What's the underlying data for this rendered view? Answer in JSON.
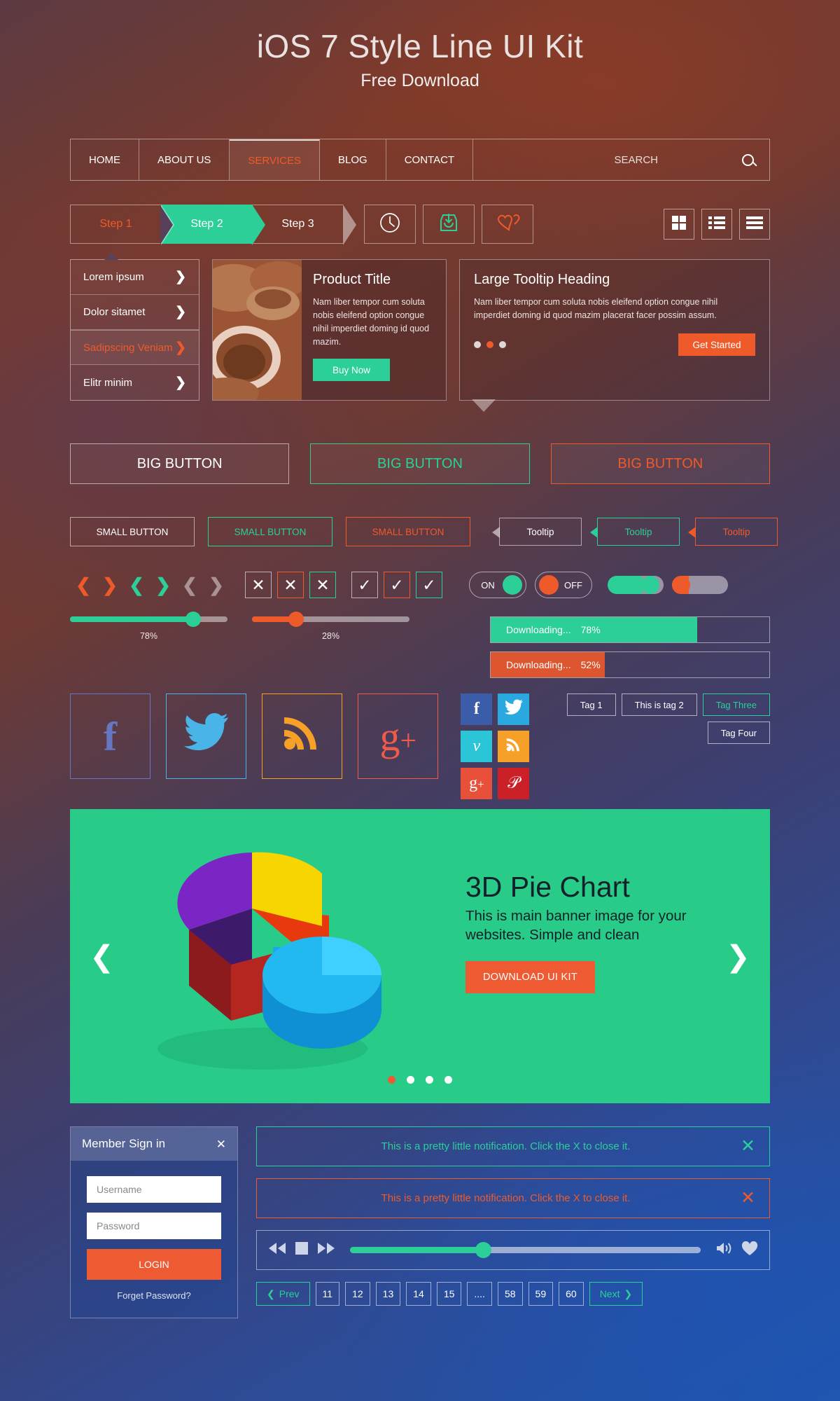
{
  "header": {
    "title": "iOS 7 Style Line UI Kit",
    "subtitle": "Free Download"
  },
  "nav": {
    "items": [
      "HOME",
      "ABOUT US",
      "SERVICES",
      "BLOG",
      "CONTACT"
    ],
    "search_placeholder": "SEARCH",
    "search_icon": "search-icon"
  },
  "steps": {
    "items": [
      "Step 1",
      "Step 2",
      "Step 3"
    ]
  },
  "icon_buttons": [
    {
      "name": "clock-icon",
      "color": "#ffffff"
    },
    {
      "name": "download-inbox-icon",
      "color": "#2bcf97"
    },
    {
      "name": "hearts-icon",
      "color": "#ef5a2a"
    }
  ],
  "view_toggles": [
    "grid-view-icon",
    "list-view-icon",
    "menu-view-icon"
  ],
  "dropdown": {
    "items": [
      {
        "label": "Lorem ipsum",
        "active": false
      },
      {
        "label": "Dolor sitamet",
        "active": false
      },
      {
        "label": "Sadipscing Veniam",
        "active": true
      },
      {
        "label": "Elitr minim",
        "active": false
      }
    ],
    "chevron": "❯"
  },
  "product_card": {
    "title": "Product Title",
    "body": "Nam liber tempor cum soluta nobis eleifend option congue nihil imperdiet doming id quod mazim.",
    "button": "Buy Now",
    "image_alt": "pottery-photo"
  },
  "tooltip_card": {
    "title": "Large Tooltip Heading",
    "body": "Nam liber tempor cum soluta nobis eleifend option congue nihil imperdiet doming id quod mazim placerat facer possim assum.",
    "button": "Get Started",
    "dots": 3,
    "active_dot": 1
  },
  "big_buttons": [
    "BIG BUTTON",
    "BIG BUTTON",
    "BIG BUTTON"
  ],
  "small_buttons": [
    "SMALL BUTTON",
    "SMALL BUTTON",
    "SMALL BUTTON"
  ],
  "tooltips": [
    "Tooltip",
    "Tooltip",
    "Tooltip"
  ],
  "checkboxes": {
    "x_mark": "✕",
    "check_mark": "✓"
  },
  "toggles": {
    "on_label": "ON",
    "off_label": "OFF"
  },
  "sliders": [
    {
      "value": 78,
      "label": "78%",
      "color": "#2bcf97"
    },
    {
      "value": 28,
      "label": "28%",
      "color": "#ef5a2a"
    }
  ],
  "progress": [
    {
      "label": "Downloading...",
      "value": "78%",
      "percent": 78,
      "color": "#2bcf97"
    },
    {
      "label": "Downloading...",
      "value": "52%",
      "percent": 52,
      "color": "#dd5630"
    }
  ],
  "social_large": [
    {
      "name": "facebook-icon",
      "glyph": "f",
      "color": "#6676c0"
    },
    {
      "name": "twitter-icon",
      "glyph": "ᴠ",
      "color": "#49b4e8"
    },
    {
      "name": "rss-icon",
      "glyph": "rss",
      "color": "#f6a028"
    },
    {
      "name": "googleplus-icon",
      "glyph": "g+",
      "color": "#ef5a4a"
    }
  ],
  "social_small": [
    {
      "name": "facebook-icon",
      "glyph": "f",
      "bg": "#3b5ca8"
    },
    {
      "name": "twitter-icon",
      "glyph": "t",
      "bg": "#2aa9e0"
    },
    {
      "name": "vimeo-icon",
      "glyph": "v",
      "bg": "#2bc5d8"
    },
    {
      "name": "rss-icon",
      "glyph": "rss",
      "bg": "#f6a028"
    },
    {
      "name": "googleplus-icon",
      "glyph": "g+",
      "bg": "#e8503a"
    },
    {
      "name": "pinterest-icon",
      "glyph": "p",
      "bg": "#cb2027"
    }
  ],
  "tags": [
    {
      "label": "Tag 1",
      "green": false
    },
    {
      "label": "This is tag 2",
      "green": false
    },
    {
      "label": "Tag Three",
      "green": true
    },
    {
      "label": "Tag Four",
      "green": false
    }
  ],
  "banner": {
    "title": "3D Pie Chart",
    "body": "This is main banner image for your websites. Simple and clean",
    "button": "DOWNLOAD UI KIT",
    "prev_icon": "chevron-left-icon",
    "next_icon": "chevron-right-icon",
    "dots": 4,
    "active_dot": 0,
    "bg_color": "#28cc88"
  },
  "login": {
    "title": "Member Sign in",
    "close_icon": "close-icon",
    "username_placeholder": "Username",
    "password_placeholder": "Password",
    "submit": "LOGIN",
    "forgot": "Forget Password?"
  },
  "notifications": [
    {
      "text": "This is a pretty little notification. Click the X to close it.",
      "color": "#2bcf97"
    },
    {
      "text": "This is a pretty little notification. Click the X to close it.",
      "color": "#ef5a2a"
    }
  ],
  "player": {
    "rewind_icon": "rewind-icon",
    "stop_icon": "stop-icon",
    "forward_icon": "fast-forward-icon",
    "volume_icon": "volume-icon",
    "heart_icon": "heart-icon",
    "progress_percent": 38
  },
  "pagination": {
    "prev": "Prev",
    "next": "Next",
    "pages": [
      "11",
      "12",
      "13",
      "14",
      "15",
      "....",
      "58",
      "59",
      "60"
    ]
  },
  "colors": {
    "green": "#2bcf97",
    "orange": "#ef5a2a",
    "banner_green": "#28cc88",
    "blue": "#1f56ad"
  }
}
